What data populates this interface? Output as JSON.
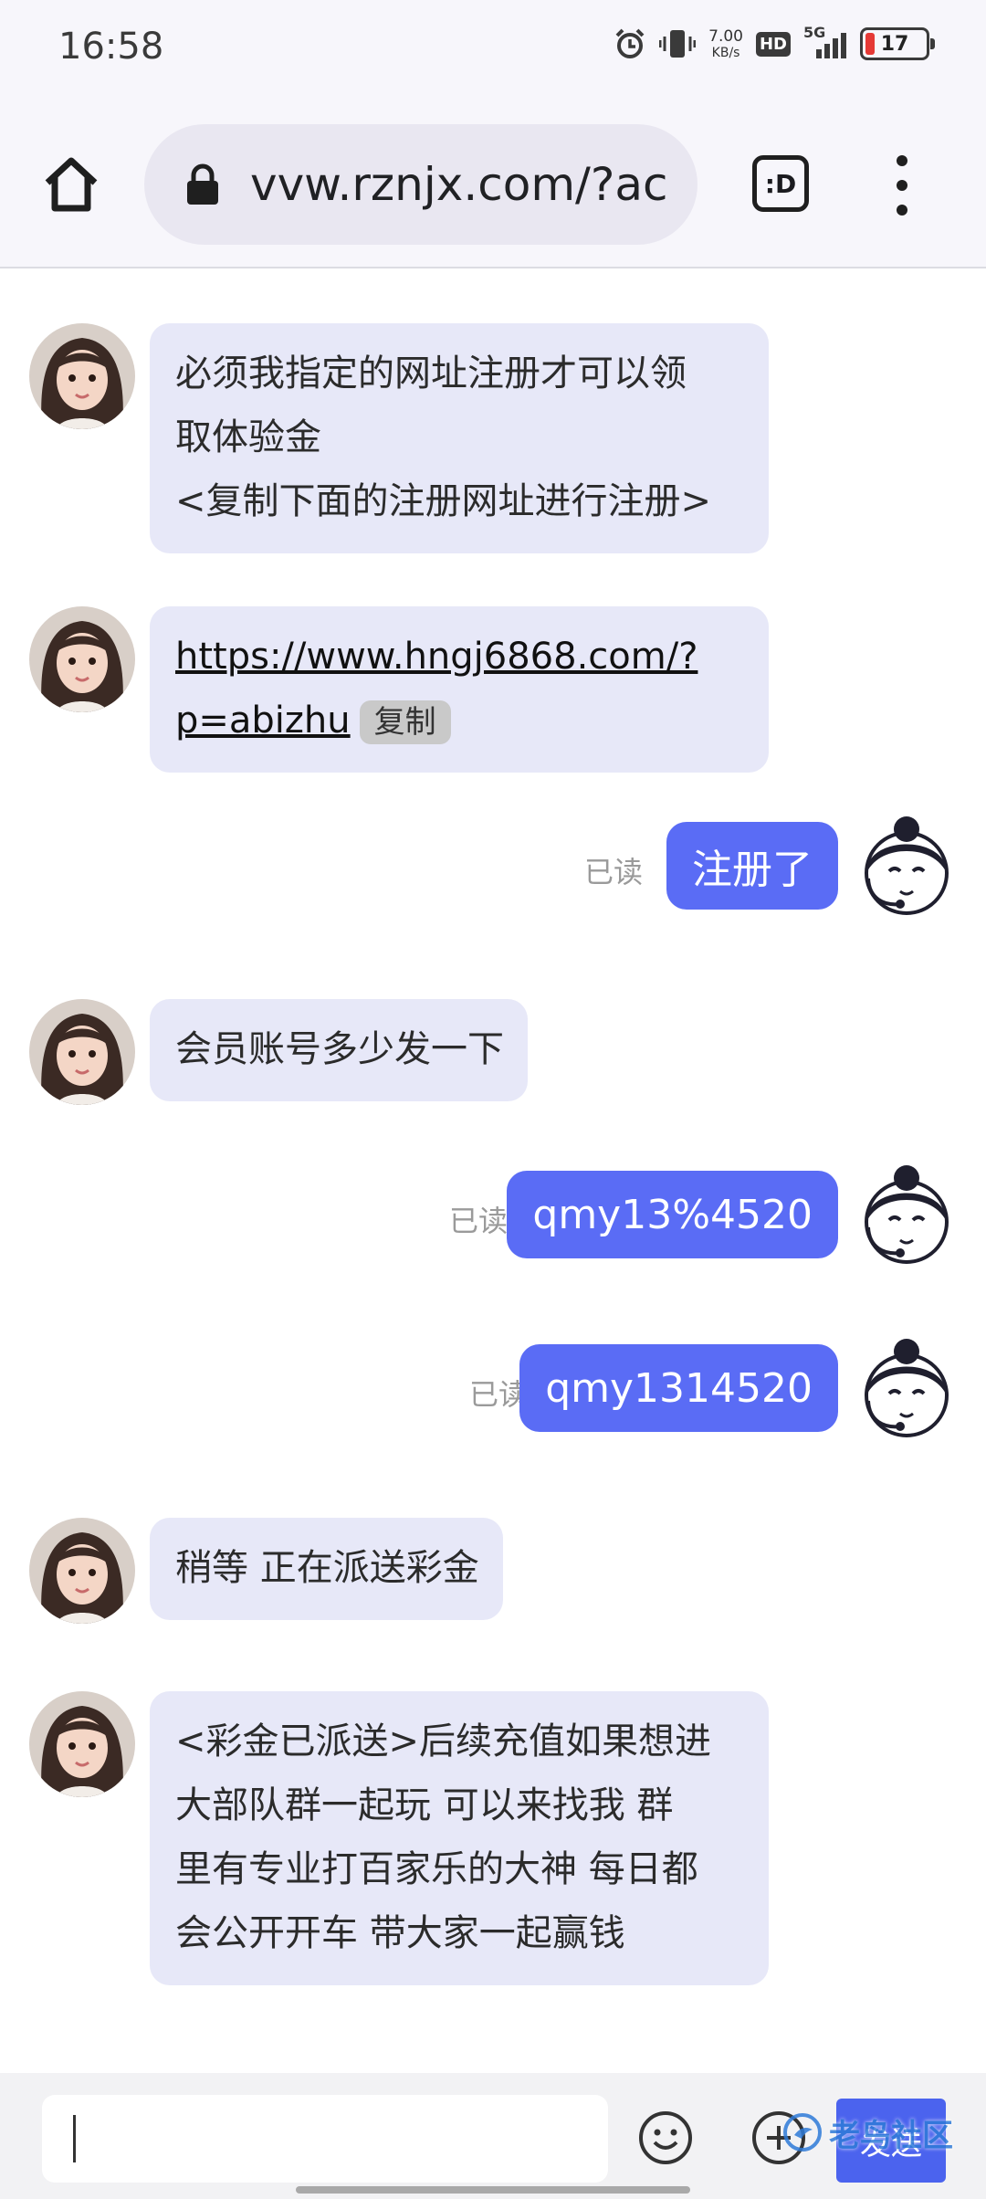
{
  "status_bar": {
    "time": "16:58",
    "net_speed_value": "7.00",
    "net_speed_unit": "KB/s",
    "hd_label": "HD",
    "network_label": "5G",
    "battery_level": "17",
    "icons": [
      "alarm-icon",
      "vibrate-icon",
      "signal-icon",
      "battery-icon"
    ]
  },
  "browser": {
    "url": "vvw.rznjx.com/?ac",
    "tabs_label": ":D",
    "icons": [
      "home-icon",
      "lock-icon",
      "tabs-icon",
      "more-menu-icon"
    ]
  },
  "messages": [
    {
      "side": "left",
      "lines": [
        "必须我指定的网址注册才可以领",
        "取体验金",
        "<复制下面的注册网址进行注册>"
      ]
    },
    {
      "side": "left",
      "link_lines": [
        "https://www.hngj6868.com/?",
        "p=abizhu"
      ],
      "copy_label": "复制"
    },
    {
      "side": "right",
      "text": "注册了",
      "status": "已读"
    },
    {
      "side": "left",
      "lines": [
        "会员账号多少发一下"
      ]
    },
    {
      "side": "right",
      "text": "qmy13%4520",
      "status": "已读"
    },
    {
      "side": "right",
      "text": "qmy1314520",
      "status": "已读"
    },
    {
      "side": "left",
      "lines": [
        "稍等 正在派送彩金"
      ]
    },
    {
      "side": "left",
      "lines": [
        "<彩金已派送>后续充值如果想进",
        "大部队群一起玩  可以来找我 群",
        "里有专业打百家乐的大神 每日都",
        "会公开开车 带大家一起赢钱"
      ]
    }
  ],
  "input_bar": {
    "input_value": "",
    "send_label": "发送",
    "watermark": "老鸟社区",
    "icons": [
      "emoji-icon",
      "add-icon"
    ]
  },
  "colors": {
    "left_bubble": "#e7e8f8",
    "right_bubble": "#5a6cf5",
    "send_button": "#4b63ee"
  }
}
